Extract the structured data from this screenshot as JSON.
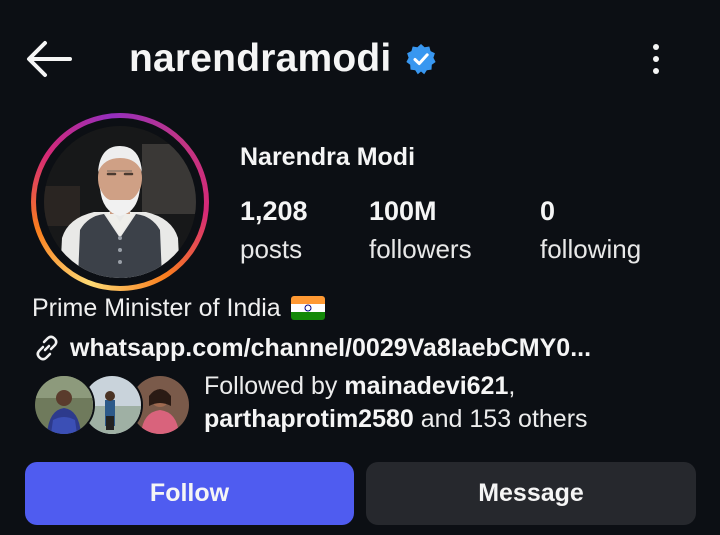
{
  "header": {
    "back_icon": "arrow-left-icon",
    "username": "narendramodi",
    "verified_icon": "verified-badge-icon",
    "verified_color": "#3897f0",
    "more_icon": "more-vertical-icon"
  },
  "profile": {
    "display_name": "Narendra Modi",
    "stats": [
      {
        "value": "1,208",
        "label": "posts"
      },
      {
        "value": "100M",
        "label": "followers"
      },
      {
        "value": "0",
        "label": "following"
      }
    ],
    "bio": "Prime Minister of India",
    "bio_flag_icon": "india-flag-icon",
    "link_icon": "link-icon",
    "link": "whatsapp.com/channel/0029Va8IaebCMY0..."
  },
  "followed_by": {
    "prefix": "Followed by ",
    "user1": "mainadevi621",
    "separator": ",",
    "user2": "parthaprotim2580",
    "suffix": " and 153 others"
  },
  "actions": {
    "follow_label": "Follow",
    "message_label": "Message",
    "follow_color": "#4f5cf0",
    "message_color": "#26282d"
  }
}
